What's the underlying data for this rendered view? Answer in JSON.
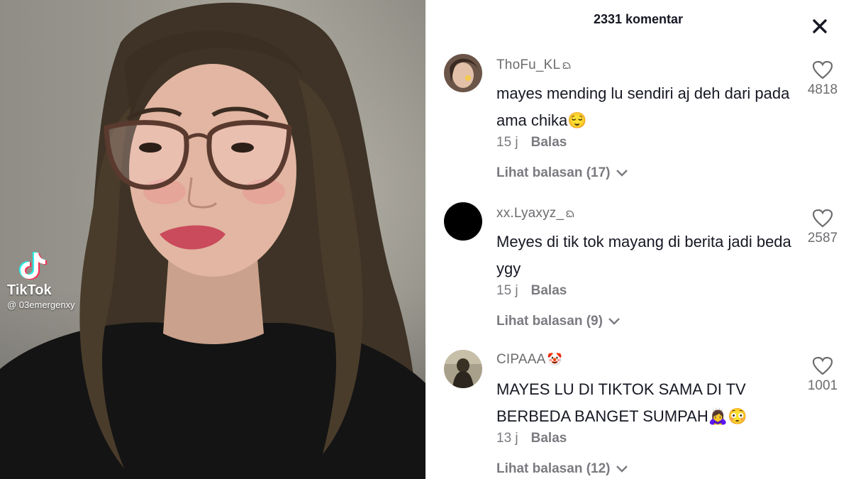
{
  "video": {
    "brand": "TikTok",
    "handle": "@ 03emergenxy"
  },
  "panel": {
    "title": "2331 komentar"
  },
  "comments": [
    {
      "username": "ThoFu_KL",
      "username_suffix": "ᨳ",
      "text": "mayes mending lu sendiri aj deh dari pada ama chika😌",
      "time": "15 j",
      "reply_label": "Balas",
      "view_replies": "Lihat balasan (17)",
      "likes": "4818",
      "avatar_color": "#c9a58a"
    },
    {
      "username": "xx.Lyaxyz_",
      "username_suffix": "ᨳ",
      "text": "Meyes di tik tok mayang di berita jadi beda ygy",
      "time": "15 j",
      "reply_label": "Balas",
      "view_replies": "Lihat balasan (9)",
      "likes": "2587",
      "avatar_color": "#000000"
    },
    {
      "username": "CIPAAA",
      "username_suffix": "🤡",
      "text": "MAYES LU DI TIKTOK SAMA DI TV BERBEDA BANGET SUMPAH🙇‍♀️😳",
      "time": "13 j",
      "reply_label": "Balas",
      "view_replies": "Lihat balasan (12)",
      "likes": "1001",
      "avatar_color": "#8a7f62"
    }
  ]
}
